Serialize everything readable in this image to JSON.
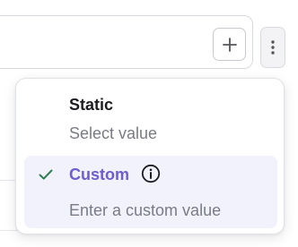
{
  "options": [
    {
      "title": "Static",
      "description": "Select value",
      "selected": false
    },
    {
      "title": "Custom",
      "description": "Enter a custom value",
      "selected": true
    }
  ],
  "icons": {
    "add": "plus-icon",
    "more": "vertical-ellipsis-icon",
    "selected": "checkmark-icon",
    "info": "info-icon"
  },
  "colors": {
    "accent": "#6f5ccf",
    "check": "#2f7d4f",
    "selected_background": "#f2f2fc",
    "muted_text": "#7a7c84"
  }
}
